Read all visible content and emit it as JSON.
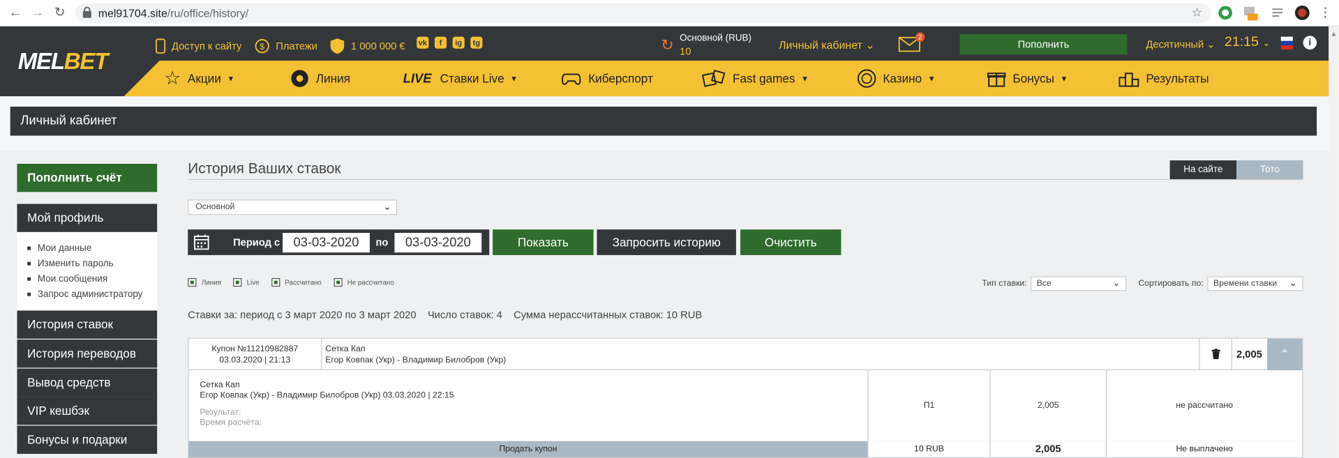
{
  "browser": {
    "url_host": "mel91704.site",
    "url_path": "/ru/office/history/"
  },
  "header": {
    "logo_mel": "MEL",
    "logo_bet": "BET",
    "site_access": "Доступ к сайту",
    "payments": "Платежи",
    "bonus_amount": "1 000 000 €",
    "social": [
      "vk",
      "f",
      "ig",
      "tg"
    ],
    "balance_label": "Основной (RUB)",
    "balance_value": "10",
    "cabinet": "Личный кабинет",
    "mail_badge": "2",
    "deposit": "Пополнить",
    "odds_format": "Десятичный",
    "time": "21:15",
    "info": "i"
  },
  "nav": {
    "promos": "Акции",
    "line": "Линия",
    "live_tag": "LIVE",
    "live": "Ставки Live",
    "esports": "Киберспорт",
    "fast_games": "Fast games",
    "casino": "Казино",
    "bonuses": "Бонусы",
    "results": "Результаты"
  },
  "page": {
    "title": "Личный кабинет"
  },
  "sidebar": {
    "deposit": "Пополнить счёт",
    "profile": "Мой профиль",
    "profile_items": [
      "Мои данные",
      "Изменить пароль",
      "Мои сообщения",
      "Запрос администратору"
    ],
    "bet_history": "История ставок",
    "transfer_history": "История переводов",
    "withdraw": "Вывод средств",
    "vip_cashback": "VIP кешбэк",
    "bonuses_gifts": "Бонусы и подарки"
  },
  "history": {
    "title": "История Ваших ставок",
    "tab_site": "На сайте",
    "tab_toto": "Тото",
    "account": "Основной",
    "period_from_label": "Период с",
    "date_from": "03-03-2020",
    "period_to_label": "по",
    "date_to": "03-03-2020",
    "show": "Показать",
    "request_history": "Запросить историю",
    "clear": "Очистить",
    "filters": [
      "Линия",
      "Live",
      "Рассчитано",
      "Не рассчитано"
    ],
    "bet_type_label": "Тип ставки:",
    "bet_type_value": "Все",
    "sort_label": "Сортировать по:",
    "sort_value": "Времени ставки",
    "summary_period": "Ставки за: период с 3 март 2020 по 3 март 2020",
    "summary_count": "Число ставок: 4",
    "summary_unsettled": "Сумма нерассчитанных ставок: 10 RUB"
  },
  "coupon": {
    "number": "Купон №11210982887",
    "datetime": "03.03.2020 | 21:13",
    "tournament": "Сетка Кап",
    "match": "Егор Ковпак (Укр) - Владимир Билобров (Укр)",
    "coef": "2,005",
    "detail_tournament": "Сетка Кап",
    "detail_match": "Егор Ковпак (Укр) - Владимир Билобров (Укр) 03.03.2020 | 22:15",
    "result_label": "Результат:",
    "settle_time_label": "Время расчёта:",
    "outcome": "П1",
    "detail_coef": "2,005",
    "status": "не рассчитано",
    "sell": "Продать купон",
    "stake": "10 RUB",
    "total_coef": "2,005",
    "payout_status": "Не выплачено"
  },
  "colors": {
    "dark": "#33373a",
    "accent": "#f3c133",
    "green": "#2f6b2d",
    "steel": "#aab8c4"
  }
}
